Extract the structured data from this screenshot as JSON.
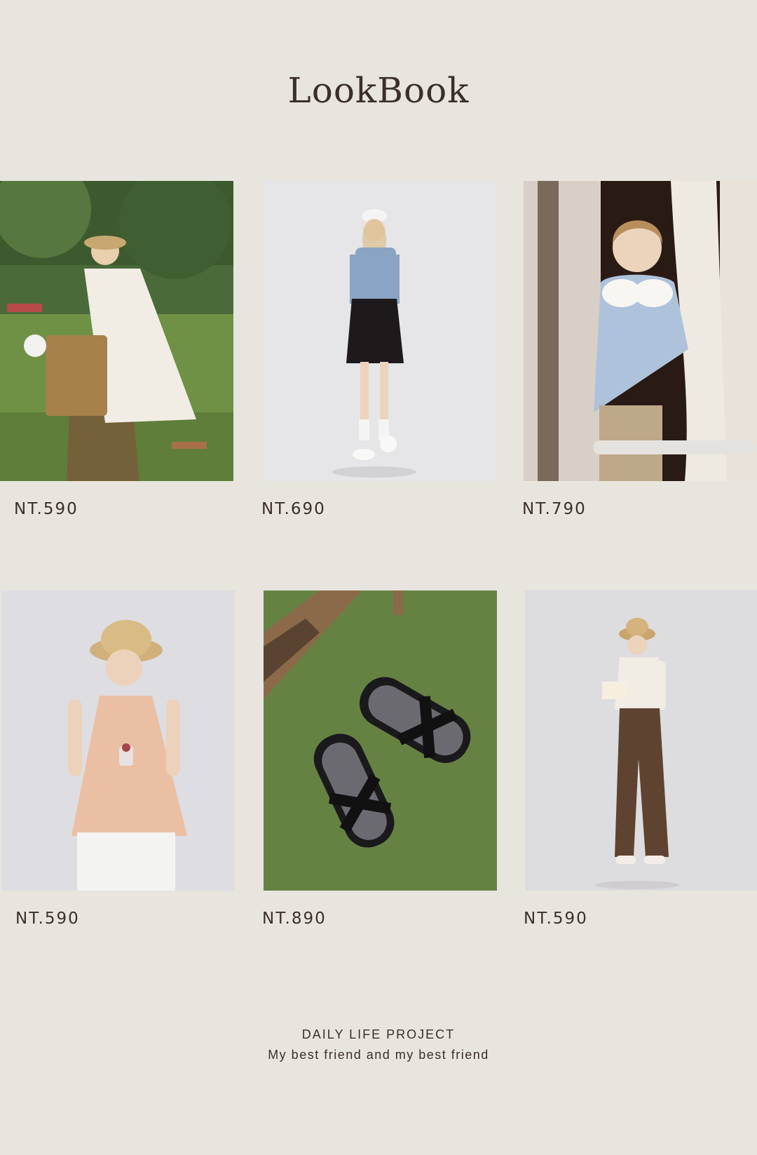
{
  "page": {
    "title": "LookBook",
    "background": "#e8e5df",
    "text_color": "#3b2f2a"
  },
  "products": [
    {
      "image": "model-white-dress-straw-bag-park",
      "price": "NT.590"
    },
    {
      "image": "model-striped-shirt-pleated-skirt",
      "price": "NT.690"
    },
    {
      "image": "model-blue-collar-blouse-window",
      "price": "NT.790"
    },
    {
      "image": "model-peach-camisole-bucket-hat",
      "price": "NT.590"
    },
    {
      "image": "black-sandals-on-grass",
      "price": "NT.890"
    },
    {
      "image": "model-white-cardigan-brown-trousers",
      "price": "NT.590"
    }
  ],
  "footer": {
    "title": "DAILY LIFE PROJECT",
    "subtitle": "My best friend and my best friend"
  }
}
